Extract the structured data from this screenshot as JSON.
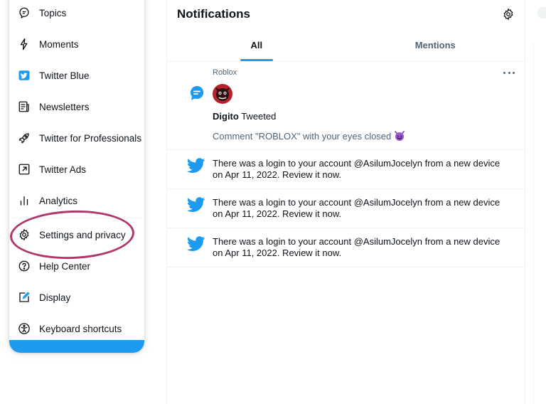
{
  "menu": {
    "items": [
      {
        "label": "Topics",
        "icon": "topics-icon"
      },
      {
        "label": "Moments",
        "icon": "lightning-icon"
      },
      {
        "label": "Twitter Blue",
        "icon": "twitter-blue-icon"
      },
      {
        "label": "Newsletters",
        "icon": "newsletter-icon"
      },
      {
        "label": "Twitter for Professionals",
        "icon": "rocket-icon"
      },
      {
        "label": "Twitter Ads",
        "icon": "external-arrow-icon"
      },
      {
        "label": "Analytics",
        "icon": "bar-chart-icon"
      },
      {
        "label": "Settings and privacy",
        "icon": "gear-icon"
      },
      {
        "label": "Help Center",
        "icon": "help-icon"
      },
      {
        "label": "Display",
        "icon": "display-pencil-icon"
      },
      {
        "label": "Keyboard shortcuts",
        "icon": "accessibility-icon"
      }
    ]
  },
  "header": {
    "title": "Notifications",
    "settings_icon": "gear-icon"
  },
  "tabs": [
    {
      "label": "All",
      "active": true
    },
    {
      "label": "Mentions",
      "active": false
    }
  ],
  "notifications": {
    "first": {
      "source": "Roblox",
      "user": "Digito",
      "action": " Tweeted",
      "comment": "Comment \"ROBLOX\" with your eyes closed",
      "icon": "speech-bubble-icon"
    },
    "login_alerts": [
      {
        "text": "There was a login to your account @AsilumJocelyn from a new device on Apr 11, 2022. Review it now."
      },
      {
        "text": "There was a login to your account @AsilumJocelyn from a new device on Apr 11, 2022. Review it now."
      },
      {
        "text": "There was a login to your account @AsilumJocelyn from a new device on Apr 11, 2022. Review it now."
      }
    ]
  },
  "colors": {
    "brand": "#1d9bf0",
    "highlight": "#b0376c",
    "text_primary": "#0f1419",
    "text_secondary": "#536471"
  }
}
